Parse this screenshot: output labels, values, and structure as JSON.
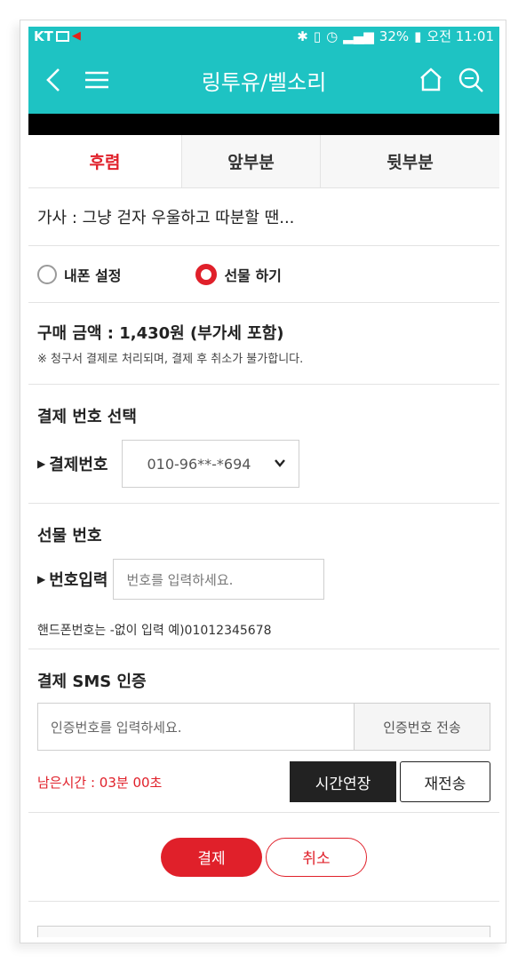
{
  "status_bar": {
    "carrier": "KT",
    "battery": "32%",
    "time": "오전 11:01"
  },
  "app_bar": {
    "title": "링투유/벨소리",
    "icons": [
      "back-arrow-icon",
      "hamburger-menu-icon",
      "home-icon",
      "search-icon"
    ]
  },
  "tabs": [
    {
      "label": "후렴",
      "selected": true
    },
    {
      "label": "앞부분",
      "selected": false
    },
    {
      "label": "뒷부분",
      "selected": false
    }
  ],
  "lyrics": "가사 : 그냥 걷자 우울하고 따분할 땐...",
  "options": [
    {
      "label": "내폰 설정",
      "selected": false
    },
    {
      "label": "선물 하기",
      "selected": true
    }
  ],
  "price": {
    "amount": "구매 금액 : 1,430원 (부가세 포함)",
    "note": "※ 청구서 결제로 처리되며, 결제 후 취소가 불가합니다."
  },
  "pay_number": {
    "section_title": "결제 번호 선택",
    "label": "결제번호",
    "selected_value": "010-96**-*694"
  },
  "gift_number": {
    "section_title": "선물 번호",
    "label": "번호입력",
    "placeholder": "번호를 입력하세요.",
    "hint": "핸드폰번호는 -없이 입력 예)01012345678"
  },
  "sms": {
    "section_title": "결제 SMS 인증",
    "placeholder": "인증번호를 입력하세요.",
    "send_label": "인증번호 전송",
    "timer": "남은시간 : 03분 00초",
    "extend_label": "시간연장",
    "resend_label": "재전송"
  },
  "actions": {
    "pay_label": "결제",
    "cancel_label": "취소"
  },
  "colors": {
    "accent": "#1ec3c3",
    "red": "#e0202a",
    "dark_button": "#222222"
  }
}
